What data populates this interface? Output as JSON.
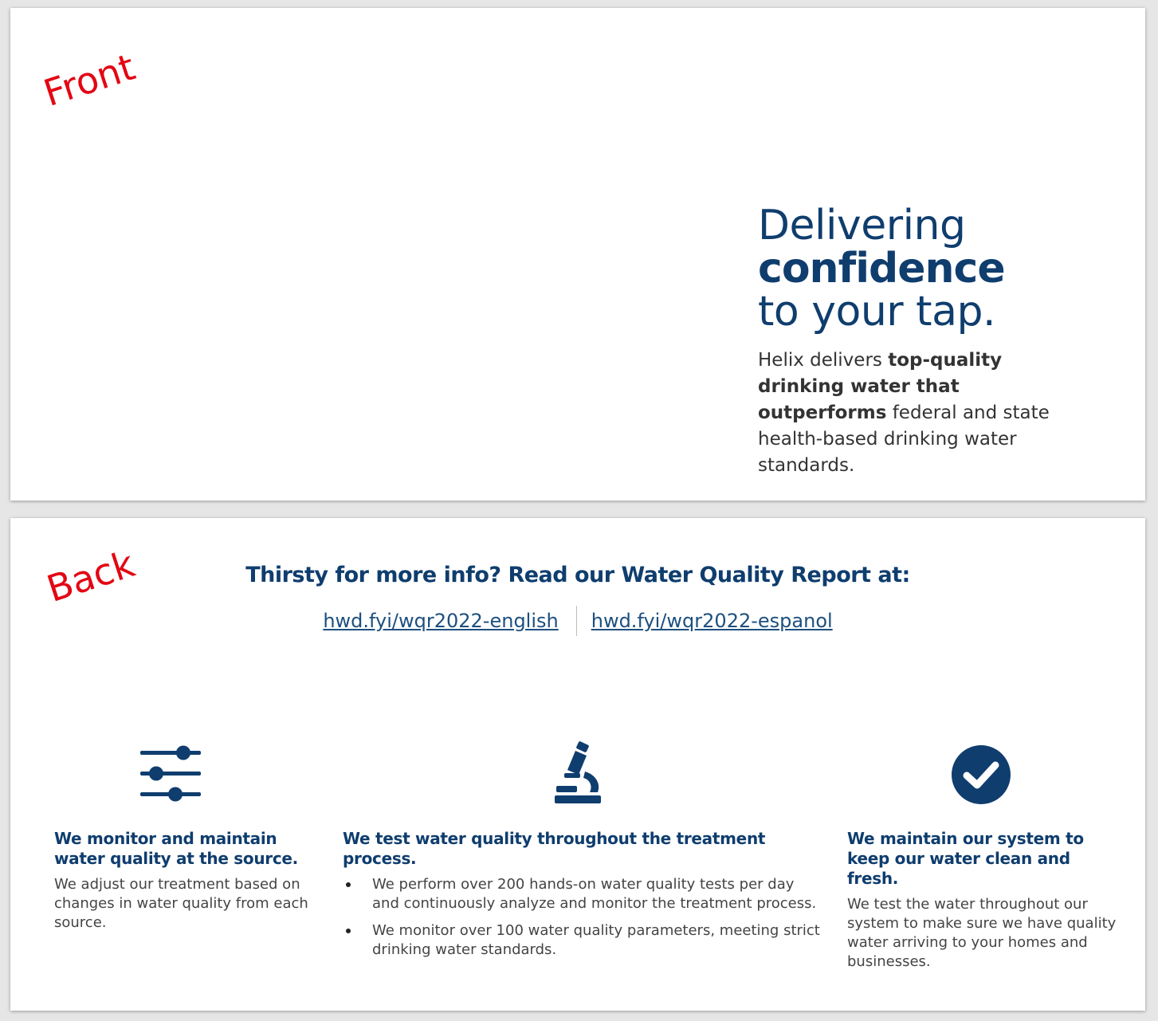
{
  "front": {
    "label": "Front",
    "headline": {
      "line1": "Delivering",
      "line2": "confidence",
      "line3": "to your tap."
    },
    "copy": {
      "part1": "Helix delivers ",
      "bold": "top-quality drinking water that outperforms",
      "part2": " federal and state health-based drinking water standards."
    }
  },
  "back": {
    "label": "Back",
    "title": "Thirsty for more info? Read our Water Quality Report at:",
    "links": [
      {
        "text": "hwd.fyi/wqr2022-english"
      },
      {
        "text": "hwd.fyi/wqr2022-espanol"
      }
    ],
    "columns": [
      {
        "icon": "sliders-icon",
        "heading": "We monitor and maintain water quality at the source.",
        "body": "We adjust our treatment based on changes in water quality from each source."
      },
      {
        "icon": "microscope-icon",
        "heading": "We test water quality throughout the treatment process.",
        "bullets": [
          "We perform over 200 hands-on water quality tests per day and continuously analyze and monitor the treatment process.",
          "We monitor over 100 water quality parameters, meeting strict drinking water standards."
        ]
      },
      {
        "icon": "check-circle-icon",
        "heading": "We maintain our system to keep our water clean and fresh.",
        "body": "We test the water throughout our system to make sure we have quality water arriving to your homes and businesses."
      }
    ]
  },
  "colors": {
    "navy": "#0f3d6e",
    "link": "#1d4f7f",
    "annotation_red": "#e30613",
    "body_text": "#444444"
  }
}
